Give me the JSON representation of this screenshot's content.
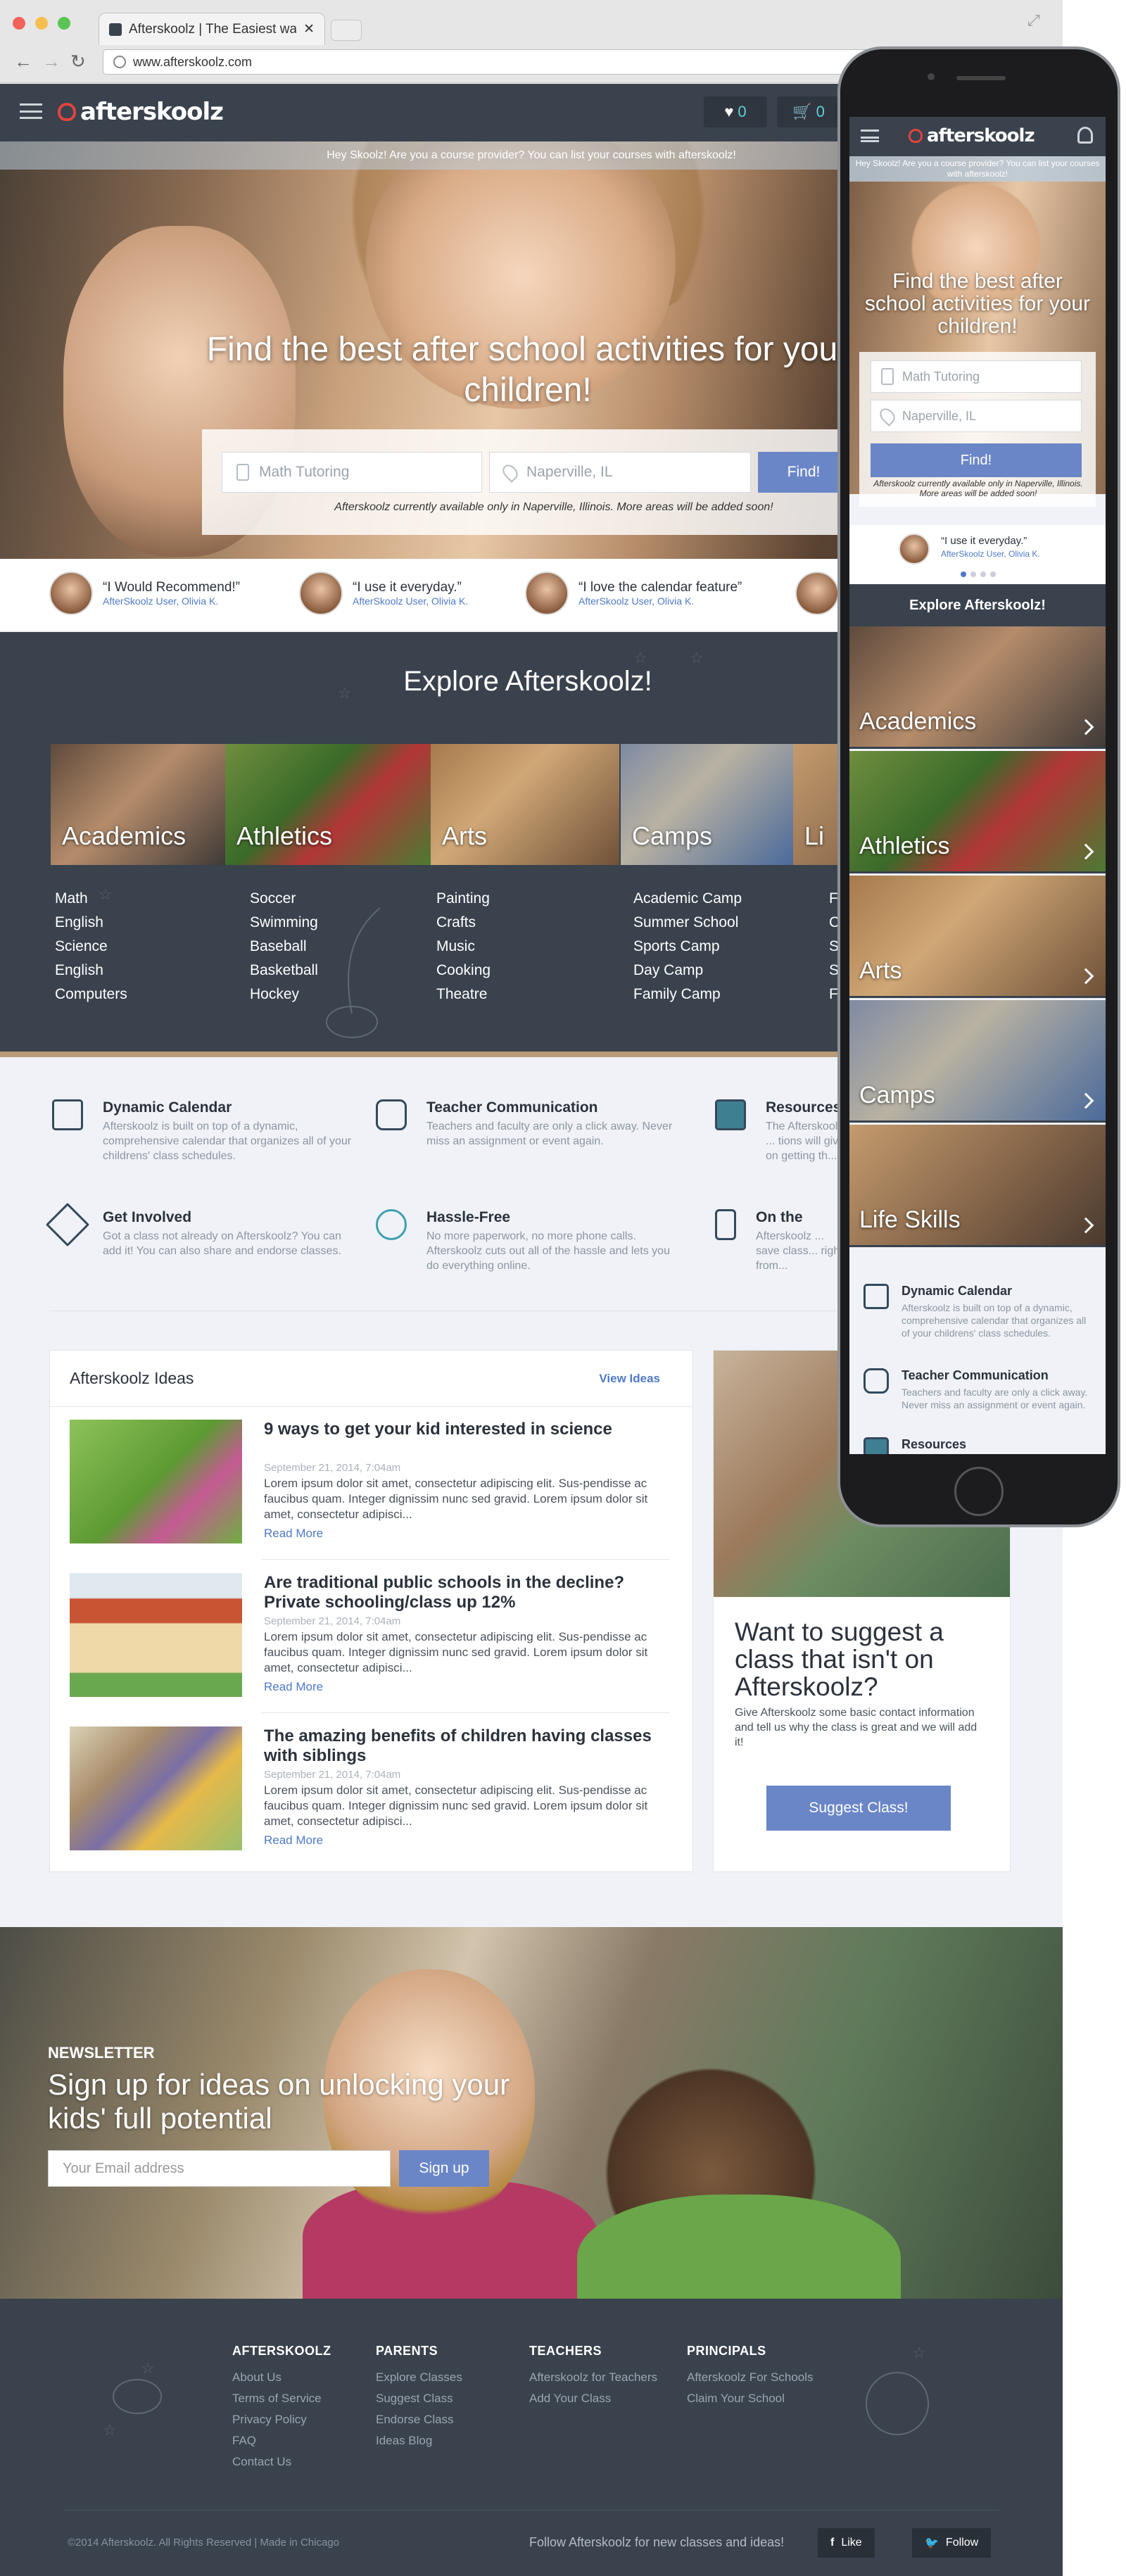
{
  "browser": {
    "tab_title": "Afterskoolz | The Easiest wa",
    "url": "www.afterskoolz.com"
  },
  "header": {
    "logo": "afterskoolz",
    "favorites_count": "0",
    "cart_count": "0"
  },
  "banner": "Hey Skoolz! Are you a course provider? You can list your courses with afterskoolz!",
  "hero": {
    "title": "Find the best after school activities for your children!",
    "subject_placeholder": "Math Tutoring",
    "location_placeholder": "Naperville, IL",
    "find_label": "Find!",
    "note": "Afterskoolz currently available only in Naperville, Illinois. More areas will be added soon!"
  },
  "testimonials": [
    {
      "quote": "“I Would Recommend!”",
      "user": "AfterSkoolz User, Olivia K."
    },
    {
      "quote": "“I use it everyday.”",
      "user": "AfterSkoolz User, Olivia K."
    },
    {
      "quote": "“I love the calendar feature”",
      "user": "AfterSkoolz User, Olivia K."
    }
  ],
  "explore": {
    "title": "Explore Afterskoolz!",
    "categories": [
      {
        "name": "Academics",
        "items": [
          "Math",
          "English",
          "Science",
          "English",
          "Computers"
        ]
      },
      {
        "name": "Athletics",
        "items": [
          "Soccer",
          "Swimming",
          "Baseball",
          "Basketball",
          "Hockey"
        ]
      },
      {
        "name": "Arts",
        "items": [
          "Painting",
          "Crafts",
          "Music",
          "Cooking",
          "Theatre"
        ]
      },
      {
        "name": "Camps",
        "items": [
          "Academic Camp",
          "Summer School",
          "Sports Camp",
          "Day Camp",
          "Family Camp"
        ]
      },
      {
        "name": "Li",
        "items": [
          "F",
          "C",
          "S",
          "S",
          "F"
        ]
      }
    ]
  },
  "features": [
    {
      "title": "Dynamic Calendar",
      "desc": "Afterskoolz is built on top of a dynamic, comprehensive calendar that organizes all of your childrens' class schedules."
    },
    {
      "title": "Teacher Communication",
      "desc": "Teachers and faculty are only a click away. Never miss an assignment or event again."
    },
    {
      "title": "Resources",
      "desc": "The Afterskoolz ... tions will giv... on getting th..."
    },
    {
      "title": "Get Involved",
      "desc": "Got a class not already on Afterskoolz? You can add it! You can also share and endorse classes."
    },
    {
      "title": "Hassle-Free",
      "desc": "No more paperwork, no more phone calls. Afterskoolz cuts out all of the hassle and lets you do everything online."
    },
    {
      "title": "On the",
      "desc": "Afterskoolz ... save class... right from..."
    }
  ],
  "ideas": {
    "title": "Afterskoolz Ideas",
    "view_label": "View Ideas",
    "read_more": "Read More",
    "articles": [
      {
        "title": "9 ways to get your kid interested in science",
        "date": "September 21, 2014, 7:04am",
        "body": "Lorem ipsum dolor sit amet, consectetur adipiscing elit. Sus-pendisse ac faucibus quam. Integer dignissim nunc sed gravid. Lorem ipsum dolor sit amet, consectetur adipisci..."
      },
      {
        "title": "Are traditional public schools in the decline? Private schooling/class up 12%",
        "date": "September 21, 2014, 7:04am",
        "body": "Lorem ipsum dolor sit amet, consectetur adipiscing elit. Sus-pendisse ac faucibus quam. Integer dignissim nunc sed gravid. Lorem ipsum dolor sit amet, consectetur adipisci..."
      },
      {
        "title": "The amazing benefits of children having classes with siblings",
        "date": "September 21, 2014, 7:04am",
        "body": "Lorem ipsum dolor sit amet, consectetur adipiscing elit. Sus-pendisse ac faucibus quam. Integer dignissim nunc sed gravid. Lorem ipsum dolor sit amet, consectetur adipisci..."
      }
    ]
  },
  "suggest": {
    "title": "Want to suggest a class that isn't on Afterskoolz?",
    "desc": "Give Afterskoolz some basic contact information and tell us why the class is great and we will add it!",
    "button": "Suggest Class!"
  },
  "newsletter": {
    "label": "NEWSLETTER",
    "title": "Sign up for ideas on unlocking your kids' full potential",
    "placeholder": "Your Email address",
    "button": "Sign up"
  },
  "footer": {
    "columns": [
      {
        "heading": "AFTERSKOOLZ",
        "links": [
          "About Us",
          "Terms of Service",
          "Privacy Policy",
          "FAQ",
          "Contact Us"
        ]
      },
      {
        "heading": "PARENTS",
        "links": [
          "Explore Classes",
          "Suggest Class",
          "Endorse Class",
          "Ideas Blog"
        ]
      },
      {
        "heading": "TEACHERS",
        "links": [
          "Afterskoolz for Teachers",
          "Add Your Class"
        ]
      },
      {
        "heading": "PRINCIPALS",
        "links": [
          "Afterskoolz For Schools",
          "Claim Your School"
        ]
      }
    ],
    "copyright": "©2014 Afterskoolz. All Rights Reserved | Made in Chicago",
    "follow_text": "Follow Afterskoolz for new classes and ideas!",
    "like_label": "Like",
    "follow_label": "Follow"
  },
  "mobile": {
    "logo": "afterskoolz",
    "banner": "Hey Skoolz! Are you a course provider? You can list your courses with afterskoolz!",
    "title": "Find the best after school activities for your children!",
    "subject_placeholder": "Math Tutoring",
    "location_placeholder": "Naperville, IL",
    "find_label": "Find!",
    "note": "Afterskoolz currently available only in Naperville, Illinois. More areas will be added soon!",
    "testimonial_quote": "“I use it everyday.”",
    "testimonial_user": "AfterSkoolz User, Olivia K.",
    "explore_title": "Explore Afterskoolz!",
    "categories": [
      "Academics",
      "Athletics",
      "Arts",
      "Camps",
      "Life Skills"
    ],
    "features": [
      {
        "title": "Dynamic Calendar",
        "desc": "Afterskoolz is built on top of a dynamic, comprehensive calendar that organizes all of your childrens' class schedules."
      },
      {
        "title": "Teacher Communication",
        "desc": "Teachers and faculty are only a click away. Never miss an assignment or event again."
      },
      {
        "title": "Resources",
        "desc": ""
      }
    ]
  },
  "colors": {
    "accent": "#6b86c7",
    "dark": "#39424d",
    "link": "#4e79c7"
  }
}
